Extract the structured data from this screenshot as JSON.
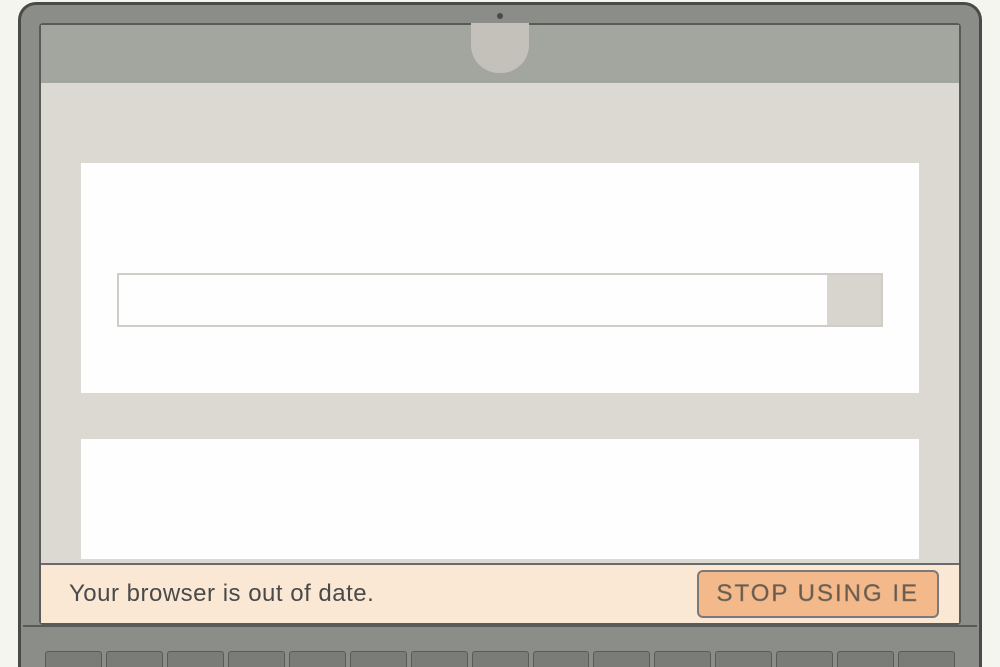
{
  "notification": {
    "message": "Your browser is out of date.",
    "button_label": "STOP USING IE"
  },
  "search": {
    "placeholder": ""
  }
}
